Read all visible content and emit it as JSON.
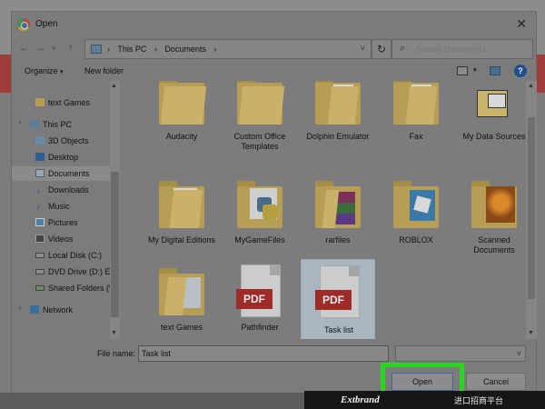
{
  "window": {
    "title": "Open"
  },
  "navigation": {
    "breadcrumbs": [
      "This PC",
      "Documents"
    ],
    "search_placeholder": "Search Documents"
  },
  "toolbar": {
    "organize_label": "Organize",
    "new_folder_label": "New folder"
  },
  "sidebar": {
    "items": [
      {
        "label": "text Games",
        "icon": "folder-icon",
        "selected": false
      },
      {
        "label": "This PC",
        "icon": "computer-icon",
        "selected": false
      },
      {
        "label": "3D Objects",
        "icon": "cube-icon",
        "selected": false
      },
      {
        "label": "Desktop",
        "icon": "desktop-icon",
        "selected": false
      },
      {
        "label": "Documents",
        "icon": "documents-icon",
        "selected": true
      },
      {
        "label": "Downloads",
        "icon": "download-icon",
        "selected": false
      },
      {
        "label": "Music",
        "icon": "music-icon",
        "selected": false
      },
      {
        "label": "Pictures",
        "icon": "pictures-icon",
        "selected": false
      },
      {
        "label": "Videos",
        "icon": "videos-icon",
        "selected": false
      },
      {
        "label": "Local Disk (C:)",
        "icon": "disk-icon",
        "selected": false
      },
      {
        "label": "DVD Drive (D:) E",
        "icon": "dvd-icon",
        "selected": false
      },
      {
        "label": "Shared Folders (\\",
        "icon": "shared-folder-icon",
        "selected": false
      },
      {
        "label": "Network",
        "icon": "network-icon",
        "selected": false
      }
    ]
  },
  "files": [
    {
      "label": "Audacity",
      "icon": "folder-icon",
      "selected": false
    },
    {
      "label": "Custom Office Templates",
      "icon": "folder-icon",
      "selected": false
    },
    {
      "label": "Dolphin Emulator",
      "icon": "folder-icon",
      "selected": false
    },
    {
      "label": "Fax",
      "icon": "folder-icon",
      "selected": false
    },
    {
      "label": "My Data Sources",
      "icon": "data-sources-icon",
      "selected": false
    },
    {
      "label": "My Digital Editions",
      "icon": "folder-icon",
      "selected": false
    },
    {
      "label": "MyGameFiles",
      "icon": "python-folder-icon",
      "selected": false
    },
    {
      "label": "rarfiles",
      "icon": "winrar-folder-icon",
      "selected": false
    },
    {
      "label": "ROBLOX",
      "icon": "roblox-folder-icon",
      "selected": false
    },
    {
      "label": "Scanned Documents",
      "icon": "photo-folder-icon",
      "selected": false
    },
    {
      "label": "text Games",
      "icon": "folder-icon",
      "selected": false
    },
    {
      "label": "Pathfinder",
      "icon": "pdf-icon",
      "selected": false
    },
    {
      "label": "Task list",
      "icon": "pdf-icon",
      "selected": true
    }
  ],
  "pdf_badge": "PDF",
  "footer": {
    "file_name_label": "File name:",
    "file_name_value": "Task list",
    "open_label": "Open",
    "cancel_label": "Cancel"
  },
  "watermark": {
    "brand": "Extbrand",
    "slogan": "进口招商平台"
  },
  "colors": {
    "highlight": "#29d61f",
    "pdf_red": "#9e2b27",
    "folder": "#c9b16a"
  }
}
